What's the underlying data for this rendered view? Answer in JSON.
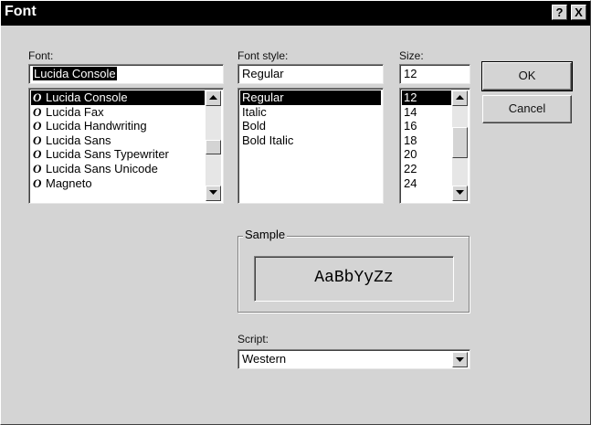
{
  "window": {
    "title": "Font",
    "help_glyph": "?",
    "close_glyph": "X"
  },
  "font": {
    "label": "Font:",
    "value": "Lucida Console",
    "icon": "truetype-font-icon",
    "icon_glyph": "O",
    "items": [
      "Lucida Console",
      "Lucida Fax",
      "Lucida Handwriting",
      "Lucida Sans",
      "Lucida Sans Typewriter",
      "Lucida Sans Unicode",
      "Magneto"
    ],
    "selected_index": 0
  },
  "style": {
    "label": "Font style:",
    "value": "Regular",
    "items": [
      "Regular",
      "Italic",
      "Bold",
      "Bold Italic"
    ],
    "selected_index": 0
  },
  "size": {
    "label": "Size:",
    "value": "12",
    "items": [
      "12",
      "14",
      "16",
      "18",
      "20",
      "22",
      "24"
    ],
    "selected_index": 0
  },
  "buttons": {
    "ok": "OK",
    "cancel": "Cancel"
  },
  "sample": {
    "title": "Sample",
    "text": "AaBbYyZz"
  },
  "script": {
    "label": "Script:",
    "value": "Western"
  },
  "colors": {
    "dialog_bg": "#d4d4d4",
    "titlebar_bg": "#000000",
    "selection_bg": "#000000"
  }
}
